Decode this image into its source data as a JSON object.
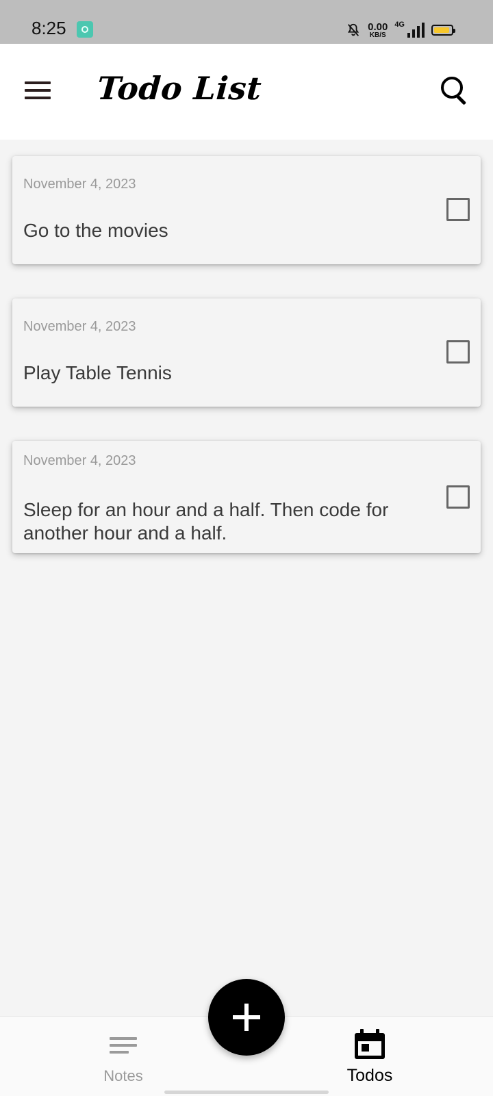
{
  "status_bar": {
    "time": "8:25",
    "net_speed_value": "0.00",
    "net_speed_unit": "KB/S",
    "network_type": "4G",
    "battery_color": "#f7c72b"
  },
  "app_bar": {
    "title": "Todo List",
    "menu_icon": "hamburger-menu-icon",
    "search_icon": "search-icon"
  },
  "todos": [
    {
      "date": "November 4, 2023",
      "text": "Go to the movies",
      "checked": false
    },
    {
      "date": "November 4, 2023",
      "text": "Play Table Tennis",
      "checked": false
    },
    {
      "date": "November 4, 2023",
      "text": "Sleep for an hour and a half. Then code for another hour and a half.",
      "checked": false
    }
  ],
  "fab": {
    "icon": "plus-icon"
  },
  "bottom_nav": {
    "items": [
      {
        "label": "Notes",
        "icon": "notes-lines-icon",
        "active": false
      },
      {
        "label": "Todos",
        "icon": "calendar-icon",
        "active": true
      }
    ]
  }
}
